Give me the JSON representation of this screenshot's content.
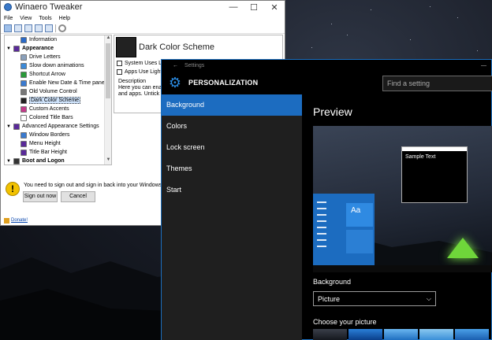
{
  "tweaker": {
    "title": "Winaero Tweaker",
    "controls": [
      "—",
      "☐",
      "✕"
    ],
    "menu": [
      "File",
      "View",
      "Tools",
      "Help"
    ],
    "tree": [
      {
        "label": "Information",
        "level": 2,
        "icon": "info-icon",
        "color": "#2a6ac8"
      },
      {
        "label": "Appearance",
        "level": 1,
        "icon": "appearance-icon",
        "color": "#5a2a9a",
        "category": true
      },
      {
        "label": "Drive Letters",
        "level": 2,
        "icon": "drive-icon",
        "color": "#8aa0bb"
      },
      {
        "label": "Slow down animations",
        "level": 2,
        "icon": "animation-icon",
        "color": "#3c8ad8"
      },
      {
        "label": "Shortcut Arrow",
        "level": 2,
        "icon": "shortcut-icon",
        "color": "#2a9a3a"
      },
      {
        "label": "Enable New Date & Time pane",
        "level": 2,
        "icon": "clock-icon",
        "color": "#3a7ad0"
      },
      {
        "label": "Old Volume Control",
        "level": 2,
        "icon": "volume-icon",
        "color": "#777777"
      },
      {
        "label": "Dark Color Scheme",
        "level": 2,
        "icon": "color-scheme-icon",
        "color": "#222222",
        "selected": true
      },
      {
        "label": "Custom Accents",
        "level": 2,
        "icon": "accent-icon",
        "color": "#c43a8a"
      },
      {
        "label": "Colored Title Bars",
        "level": 2,
        "icon": "titlebar-icon",
        "color": "#ffffff"
      },
      {
        "label": "Advanced Appearance Settings",
        "level": 1,
        "icon": "advanced-appearance-icon",
        "color": "#5a2a9a"
      },
      {
        "label": "Window Borders",
        "level": 2,
        "icon": "window-border-icon",
        "color": "#3a7ad0"
      },
      {
        "label": "Menu Height",
        "level": 2,
        "icon": "menu-height-icon",
        "color": "#5a2a9a"
      },
      {
        "label": "Title Bar Height",
        "level": 2,
        "icon": "titlebar-height-icon",
        "color": "#5a2a9a"
      },
      {
        "label": "Boot and Logon",
        "level": 1,
        "icon": "boot-icon",
        "color": "#333333",
        "category": true
      }
    ],
    "detail": {
      "title": "Dark Color Scheme",
      "checkbox1": "System Uses Light",
      "checkbox2": "Apps Use Light Th",
      "desc_label": "Description",
      "desc_line1": "Here you can enable",
      "desc_line2": "and apps. Untick th"
    },
    "notice": "You need to sign out and sign in back into your Windows session fo",
    "sign_out": "Sign out now",
    "cancel": "Cancel",
    "donate": "Donate!"
  },
  "settings": {
    "window_title": "Settings",
    "heading": "PERSONALIZATION",
    "search_placeholder": "Find a setting",
    "nav": [
      "Background",
      "Colors",
      "Lock screen",
      "Themes",
      "Start"
    ],
    "preview_title": "Preview",
    "preview_aa": "Aa",
    "preview_sample": "Sample Text",
    "background_label": "Background",
    "background_value": "Picture",
    "choose_label": "Choose your picture"
  },
  "colors": {
    "accent": "#1c6cc0",
    "settings_bg": "#000000",
    "nav_bg": "#1f1f1f"
  }
}
